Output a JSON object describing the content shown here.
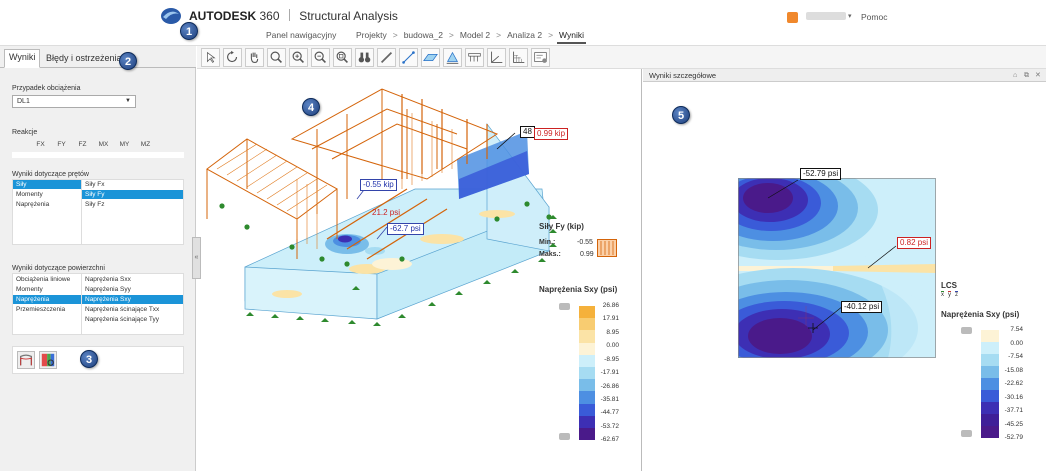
{
  "header": {
    "brand_name": "AUTODESK",
    "brand_360": "360",
    "brand_product": "Structural Analysis",
    "nav_home": "Panel nawigacyjny",
    "breadcrumbs": [
      "Projekty",
      "budowa_2",
      "Model 2",
      "Analiza 2",
      "Wyniki"
    ],
    "help": "Pomoc"
  },
  "callouts": [
    "1",
    "2",
    "3",
    "4",
    "5"
  ],
  "left_panel": {
    "tabs": [
      "Wyniki",
      "Błędy i ostrzeżenia"
    ],
    "load_case_label": "Przypadek obciążenia",
    "load_case_value": "DL1",
    "reactions_label": "Reakcje",
    "reaction_columns": [
      "FX",
      "FY",
      "FZ",
      "MX",
      "MY",
      "MZ"
    ],
    "member_results_label": "Wyniki dotyczące prętów",
    "member_categories": [
      "Siły",
      "Momenty",
      "Naprężenia"
    ],
    "member_items": [
      "Siły Fx",
      "Siły Fy",
      "Siły Fz"
    ],
    "surface_results_label": "Wyniki dotyczące powierzchni",
    "surface_categories": [
      "Obciążenia liniowe",
      "Momenty",
      "Naprężenia",
      "Przemieszczenia"
    ],
    "surface_items": [
      "Naprężenia Sxx",
      "Naprężenia Syy",
      "Naprężenia Sxy",
      "Naprężenia ścinające Txx",
      "Naprężenia ścinające Tyy"
    ]
  },
  "toolbar_icons": [
    "select-icon",
    "rotate-icon",
    "pan-icon",
    "zoom-icon",
    "zoom-in-icon",
    "zoom-out-icon",
    "zoom-fit-icon",
    "binoculars-icon",
    "member-icon",
    "line-icon",
    "surface-icon",
    "support-icon",
    "load-icon",
    "axes-icon",
    "grid-icon",
    "settings-icon"
  ],
  "viewport": {
    "tags": {
      "t48": "48",
      "t099": "0.99 kip",
      "t055": "-0.55 kip",
      "t21": "21.2 psi",
      "t627": "-62.7 psi"
    },
    "forces_legend": {
      "title": "Siły Fy (kip)",
      "min_label": "Min.:",
      "min_value": "-0.55",
      "max_label": "Maks.:",
      "max_value": "0.99"
    },
    "stress_legend": {
      "title": "Naprężenia Sxy (psi)",
      "values": [
        "26.86",
        "17.91",
        "8.95",
        "0.00",
        "-8.95",
        "-17.91",
        "-26.86",
        "-35.81",
        "-44.77",
        "-53.72",
        "-62.67"
      ],
      "colors": [
        "#f5b13b",
        "#f8cc71",
        "#fbe3a6",
        "#fdf3d6",
        "#cdeffa",
        "#a6dcf2",
        "#79bde9",
        "#4d8fe2",
        "#3a5bd8",
        "#3d2fb4",
        "#4a1a8a"
      ]
    }
  },
  "detail_panel": {
    "title": "Wyniki szczegółowe",
    "tags": {
      "a": "-52.79 psi",
      "b": "0.82 psi",
      "c": "-40.12 psi"
    },
    "lcs_label": "LCS",
    "lcs_axes": [
      "x",
      "y",
      "z"
    ],
    "stress_legend": {
      "title": "Naprężenia Sxy (psi)",
      "values": [
        "7.54",
        "0.00",
        "-7.54",
        "-15.08",
        "-22.62",
        "-30.16",
        "-37.71",
        "-45.25",
        "-52.79"
      ],
      "colors": [
        "#fdf3d6",
        "#cdeffa",
        "#a6dcf2",
        "#79bde9",
        "#4d8fe2",
        "#3a5bd8",
        "#3d2fb4",
        "#3f1f98",
        "#4a1a8a"
      ]
    }
  }
}
